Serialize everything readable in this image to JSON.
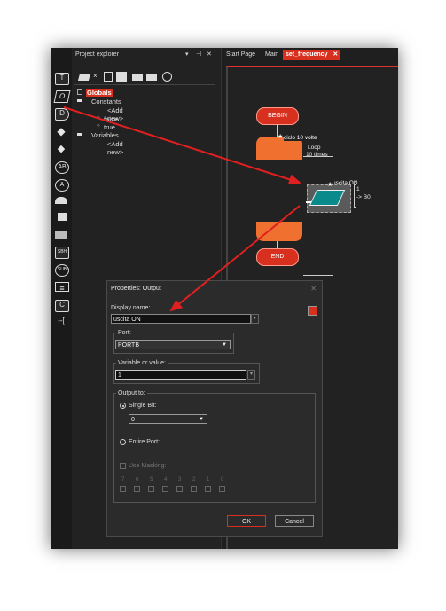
{
  "toolbar_icons": [
    "T",
    "O",
    "D",
    "",
    "",
    "",
    "AB",
    "A",
    "",
    "",
    "",
    "SBH",
    "SUB",
    "",
    "C",
    "--["
  ],
  "project_explorer": {
    "title": "Project explorer",
    "tree": {
      "globals": "Globals",
      "constants": "Constants",
      "add_new_1": "<Add new>",
      "false": "false",
      "true": "true",
      "variables": "Variables",
      "add_new_2": "<Add new>"
    }
  },
  "tabs": [
    "Start Page",
    "Main",
    "set_frequency"
  ],
  "flowchart": {
    "begin": "BEGIN",
    "loop_label": "ciclo 10 volte",
    "loop_type": "Loop",
    "loop_count": "10 times",
    "output_label": "uscita ON",
    "output_value": "1",
    "output_target": "-> B0",
    "end": "END"
  },
  "dialog": {
    "title": "Properties: Output",
    "display_name_label": "Display name:",
    "display_name_value": "uscita ON",
    "port_label": "Port:",
    "port_value": "PORTB",
    "variable_label": "Variable or value:",
    "variable_value": "1",
    "output_to_label": "Output to:",
    "single_bit_label": "Single Bit:",
    "single_bit_value": "0",
    "entire_port_label": "Entire Port:",
    "use_masking_label": "Use Masking:",
    "bits": [
      "7",
      "6",
      "5",
      "4",
      "3",
      "2",
      "1",
      "0"
    ],
    "ok": "OK",
    "cancel": "Cancel"
  },
  "colors": {
    "accent": "#d8301f",
    "loop": "#f07030",
    "output": "#0a8a8a"
  }
}
